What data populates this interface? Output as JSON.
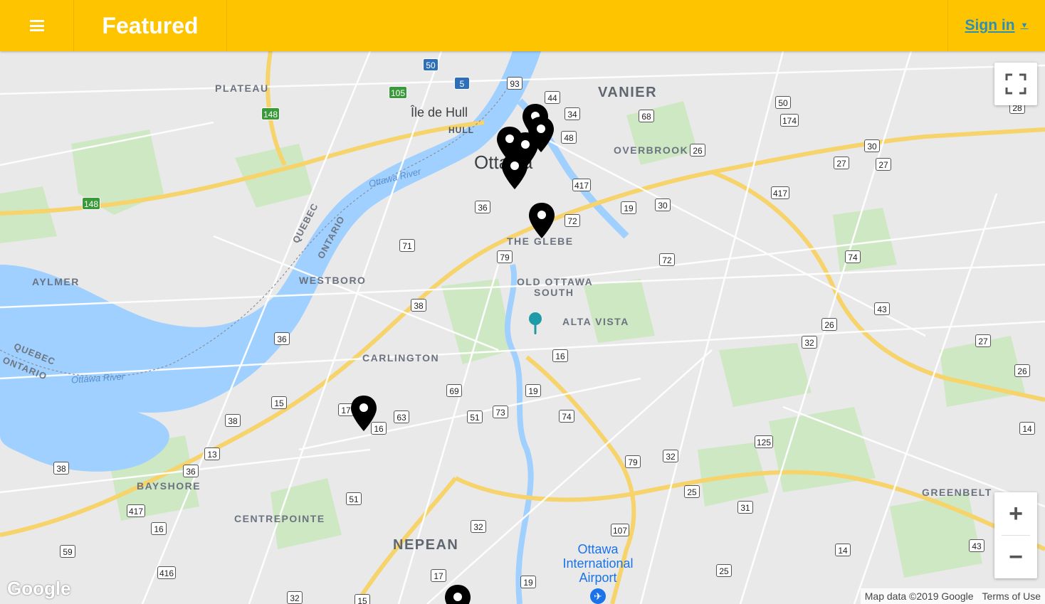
{
  "header": {
    "title": "Featured",
    "signin_label": "Sign in",
    "signin_caret": "▼",
    "menu_icon": "hamburger-icon",
    "brand_color": "#ffc400",
    "link_color": "#2c8fb5"
  },
  "map": {
    "labels": {
      "vanier": "VANIER",
      "plateau": "PLATEAU",
      "overbrook": "OVERBROOK",
      "ile_de_hull": "Île de Hull",
      "hull": "HULL",
      "ottawa": "Ottawa",
      "the_glebe": "THE GLEBE",
      "old_ottawa_south_1": "OLD OTTAWA",
      "old_ottawa_south_2": "SOUTH",
      "alta_vista": "ALTA VISTA",
      "aylmer": "AYLMER",
      "westboro": "WESTBORO",
      "carlington": "CARLINGTON",
      "bayshore": "BAYSHORE",
      "centrepointe": "CENTREPOINTE",
      "nepean": "NEPEAN",
      "greenbelt": "GREENBELT",
      "ottawa_river_1": "Ottawa River",
      "ottawa_river_2": "Ottawa River",
      "quebec_1": "QUEBEC",
      "ontario_1": "ONTARIO",
      "quebec_2": "QUEBEC",
      "ontario_2": "ONTARIO",
      "airport_1": "Ottawa",
      "airport_2": "International",
      "airport_3": "Airport"
    },
    "shields": {
      "s50": "50",
      "s5": "5",
      "s105": "105",
      "s148a": "148",
      "s148b": "148",
      "s93": "93",
      "s44": "44",
      "s34": "34",
      "s48": "48",
      "s68": "68",
      "s50b": "50",
      "s174": "174",
      "s28": "28",
      "s26a": "26",
      "s30a": "30",
      "s27a": "27",
      "s27b": "27",
      "s417a": "417",
      "s417b": "417",
      "s36a": "36",
      "s72a": "72",
      "s19a": "19",
      "s30b": "30",
      "s71": "71",
      "s79a": "79",
      "s72b": "72",
      "s74a": "74",
      "s43a": "43",
      "s38a": "38",
      "s26b": "26",
      "s32a": "32",
      "s27c": "27",
      "s26c": "26",
      "s36b": "36",
      "s16a": "16",
      "s69": "69",
      "s19b": "19",
      "s15": "15",
      "s17a": "17",
      "s16b": "16",
      "s63": "63",
      "s51a": "51",
      "s73": "73",
      "s74b": "74",
      "s14a": "14",
      "s38b": "38",
      "s13": "13",
      "s38c": "38",
      "s36c": "36",
      "s125": "125",
      "s79b": "79",
      "s32b": "32",
      "s417c": "417",
      "s16c": "16",
      "s51b": "51",
      "s25a": "25",
      "s31": "31",
      "s107": "107",
      "s32c": "32",
      "s59": "59",
      "s416": "416",
      "s17b": "17",
      "s19c": "19",
      "s14b": "14",
      "s43b": "43",
      "s25b": "25",
      "s32d": "32",
      "s15b": "15"
    },
    "controls": {
      "fullscreen_icon": "fullscreen-icon",
      "zoom_in": "+",
      "zoom_out": "−"
    },
    "footer": {
      "logo": "Google",
      "attribution": "Map data ©2019 Google",
      "terms": "Terms of Use"
    }
  }
}
